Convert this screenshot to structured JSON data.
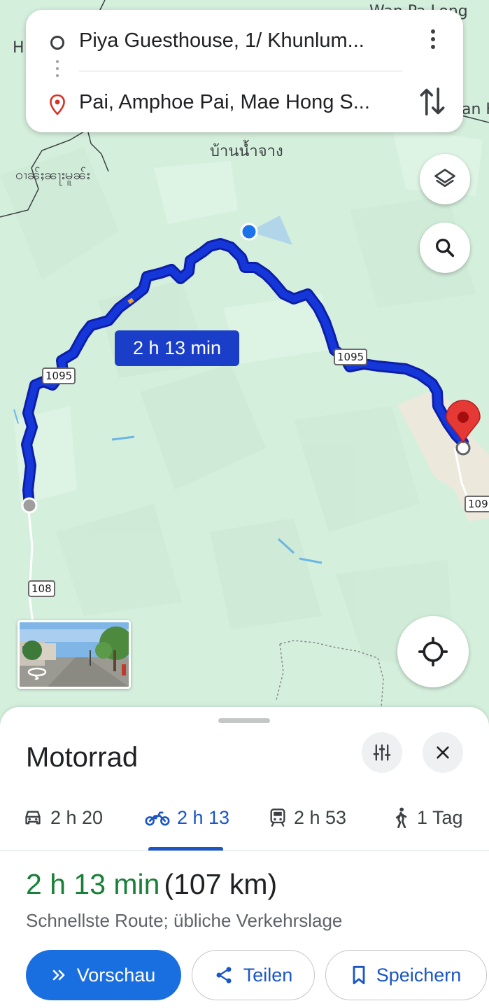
{
  "route_search": {
    "origin": "Piya Guesthouse, 1/ Khunlum...",
    "destination": "Pai, Amphoe Pai, Mae Hong S..."
  },
  "map": {
    "place_labels": {
      "top_right": "Wan Pa Long",
      "top_left_fragment": "H",
      "right_fragment": "an H",
      "thai_village": "บ้านน้ำจาง",
      "shan_label": "ဝၢၼ်ႈၼႃးမူၼ်း"
    },
    "road_shields": {
      "road_a": "1095",
      "road_b": "1095",
      "road_c": "109",
      "road_d": "108"
    },
    "route_badge": "2 h 13 min",
    "colors": {
      "route": "#1537d9",
      "route_outline": "#0d1ea8",
      "map_green": "#d5efdd",
      "urban": "#ede8dc",
      "destination_pin": "#e53935"
    }
  },
  "sheet": {
    "title": "Motorrad",
    "modes": [
      {
        "icon": "car-icon",
        "time": "2 h 20"
      },
      {
        "icon": "motorcycle-icon",
        "time": "2 h 13",
        "active": true
      },
      {
        "icon": "transit-icon",
        "time": "2 h 53"
      },
      {
        "icon": "walk-icon",
        "time": "1 Tag"
      }
    ],
    "duration": "2 h 13 min",
    "distance": "(107 km)",
    "description": "Schnellste Route; übliche Verkehrslage",
    "buttons": {
      "preview": "Vorschau",
      "share": "Teilen",
      "save": "Speichern"
    },
    "colors": {
      "primary": "#1a6fe0",
      "active_tab": "#1a56c6",
      "duration_green": "#188038"
    }
  }
}
